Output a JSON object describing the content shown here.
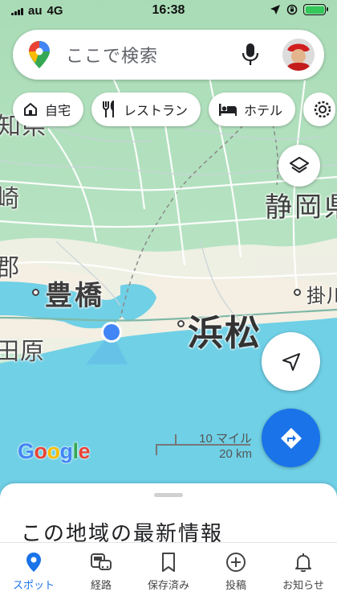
{
  "status_bar": {
    "carrier": "au",
    "network": "4G",
    "time": "16:38"
  },
  "search": {
    "placeholder": "ここで検索"
  },
  "chips": [
    {
      "label": "自宅",
      "icon": "home-icon"
    },
    {
      "label": "レストラン",
      "icon": "restaurant-icon"
    },
    {
      "label": "ホテル",
      "icon": "hotel-icon"
    }
  ],
  "map": {
    "labels": {
      "aichi_partial": "知県",
      "okazaki_partial": "崎",
      "gamagori_partial": "郡",
      "tahara_partial": "田原",
      "toyohashi": "豊橋",
      "hamamatsu": "浜松",
      "shizuoka_partial": "静岡県",
      "kakegawa_partial": "掛川"
    }
  },
  "scale": {
    "miles": "10 マイル",
    "km": "20 km"
  },
  "logo": {
    "text": "Google"
  },
  "sheet": {
    "title": "この地域の最新情報"
  },
  "nav": [
    {
      "label": "スポット",
      "icon": "pin-icon",
      "active": true
    },
    {
      "label": "経路",
      "icon": "commute-icon",
      "active": false
    },
    {
      "label": "保存済み",
      "icon": "bookmark-icon",
      "active": false
    },
    {
      "label": "投稿",
      "icon": "add-circle-icon",
      "active": false
    },
    {
      "label": "お知らせ",
      "icon": "bell-icon",
      "active": false
    }
  ],
  "colors": {
    "accent": "#1a73e8",
    "water": "#6fd0e6",
    "land": "#b7e7c7",
    "urban": "#f3eee3"
  }
}
